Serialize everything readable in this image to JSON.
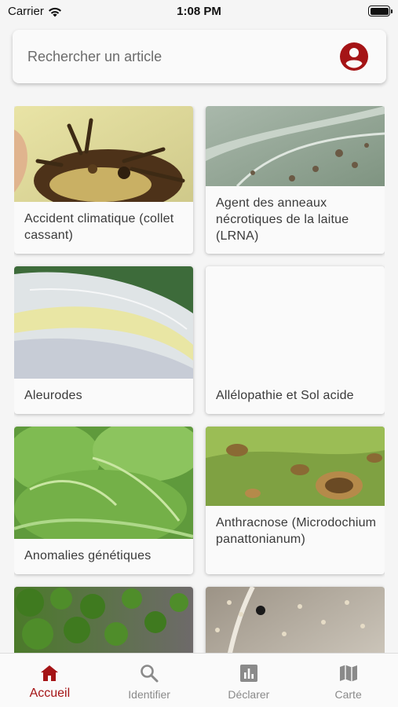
{
  "status_bar": {
    "carrier": "Carrier",
    "time": "1:08 PM"
  },
  "search": {
    "placeholder": "Rechercher un article"
  },
  "accent_color": "#a51416",
  "articles": [
    {
      "label": "Accident climatique (collet cassant)",
      "image": "root-crown-photo"
    },
    {
      "label": "Agent des anneaux nécrotiques de la laitue (LRNA)",
      "image": "spotted-leaf-photo"
    },
    {
      "label": "Aleurodes",
      "image": "lettuce-leaf-closeup-photo"
    },
    {
      "label": "Allélopathie et Sol acide",
      "image": ""
    },
    {
      "label": "Anomalies génétiques",
      "image": "green-lettuce-photo"
    },
    {
      "label": "Anthracnose (Microdochium panattonianum)",
      "image": "anthracnose-leaf-photo"
    },
    {
      "label": "",
      "image": "lettuce-rows-photo"
    },
    {
      "label": "",
      "image": "mildew-leaf-photo"
    }
  ],
  "tabs": [
    {
      "label": "Accueil",
      "icon": "home-icon",
      "active": true
    },
    {
      "label": "Identifier",
      "icon": "search-icon",
      "active": false
    },
    {
      "label": "Déclarer",
      "icon": "chart-icon",
      "active": false
    },
    {
      "label": "Carte",
      "icon": "map-icon",
      "active": false
    }
  ]
}
